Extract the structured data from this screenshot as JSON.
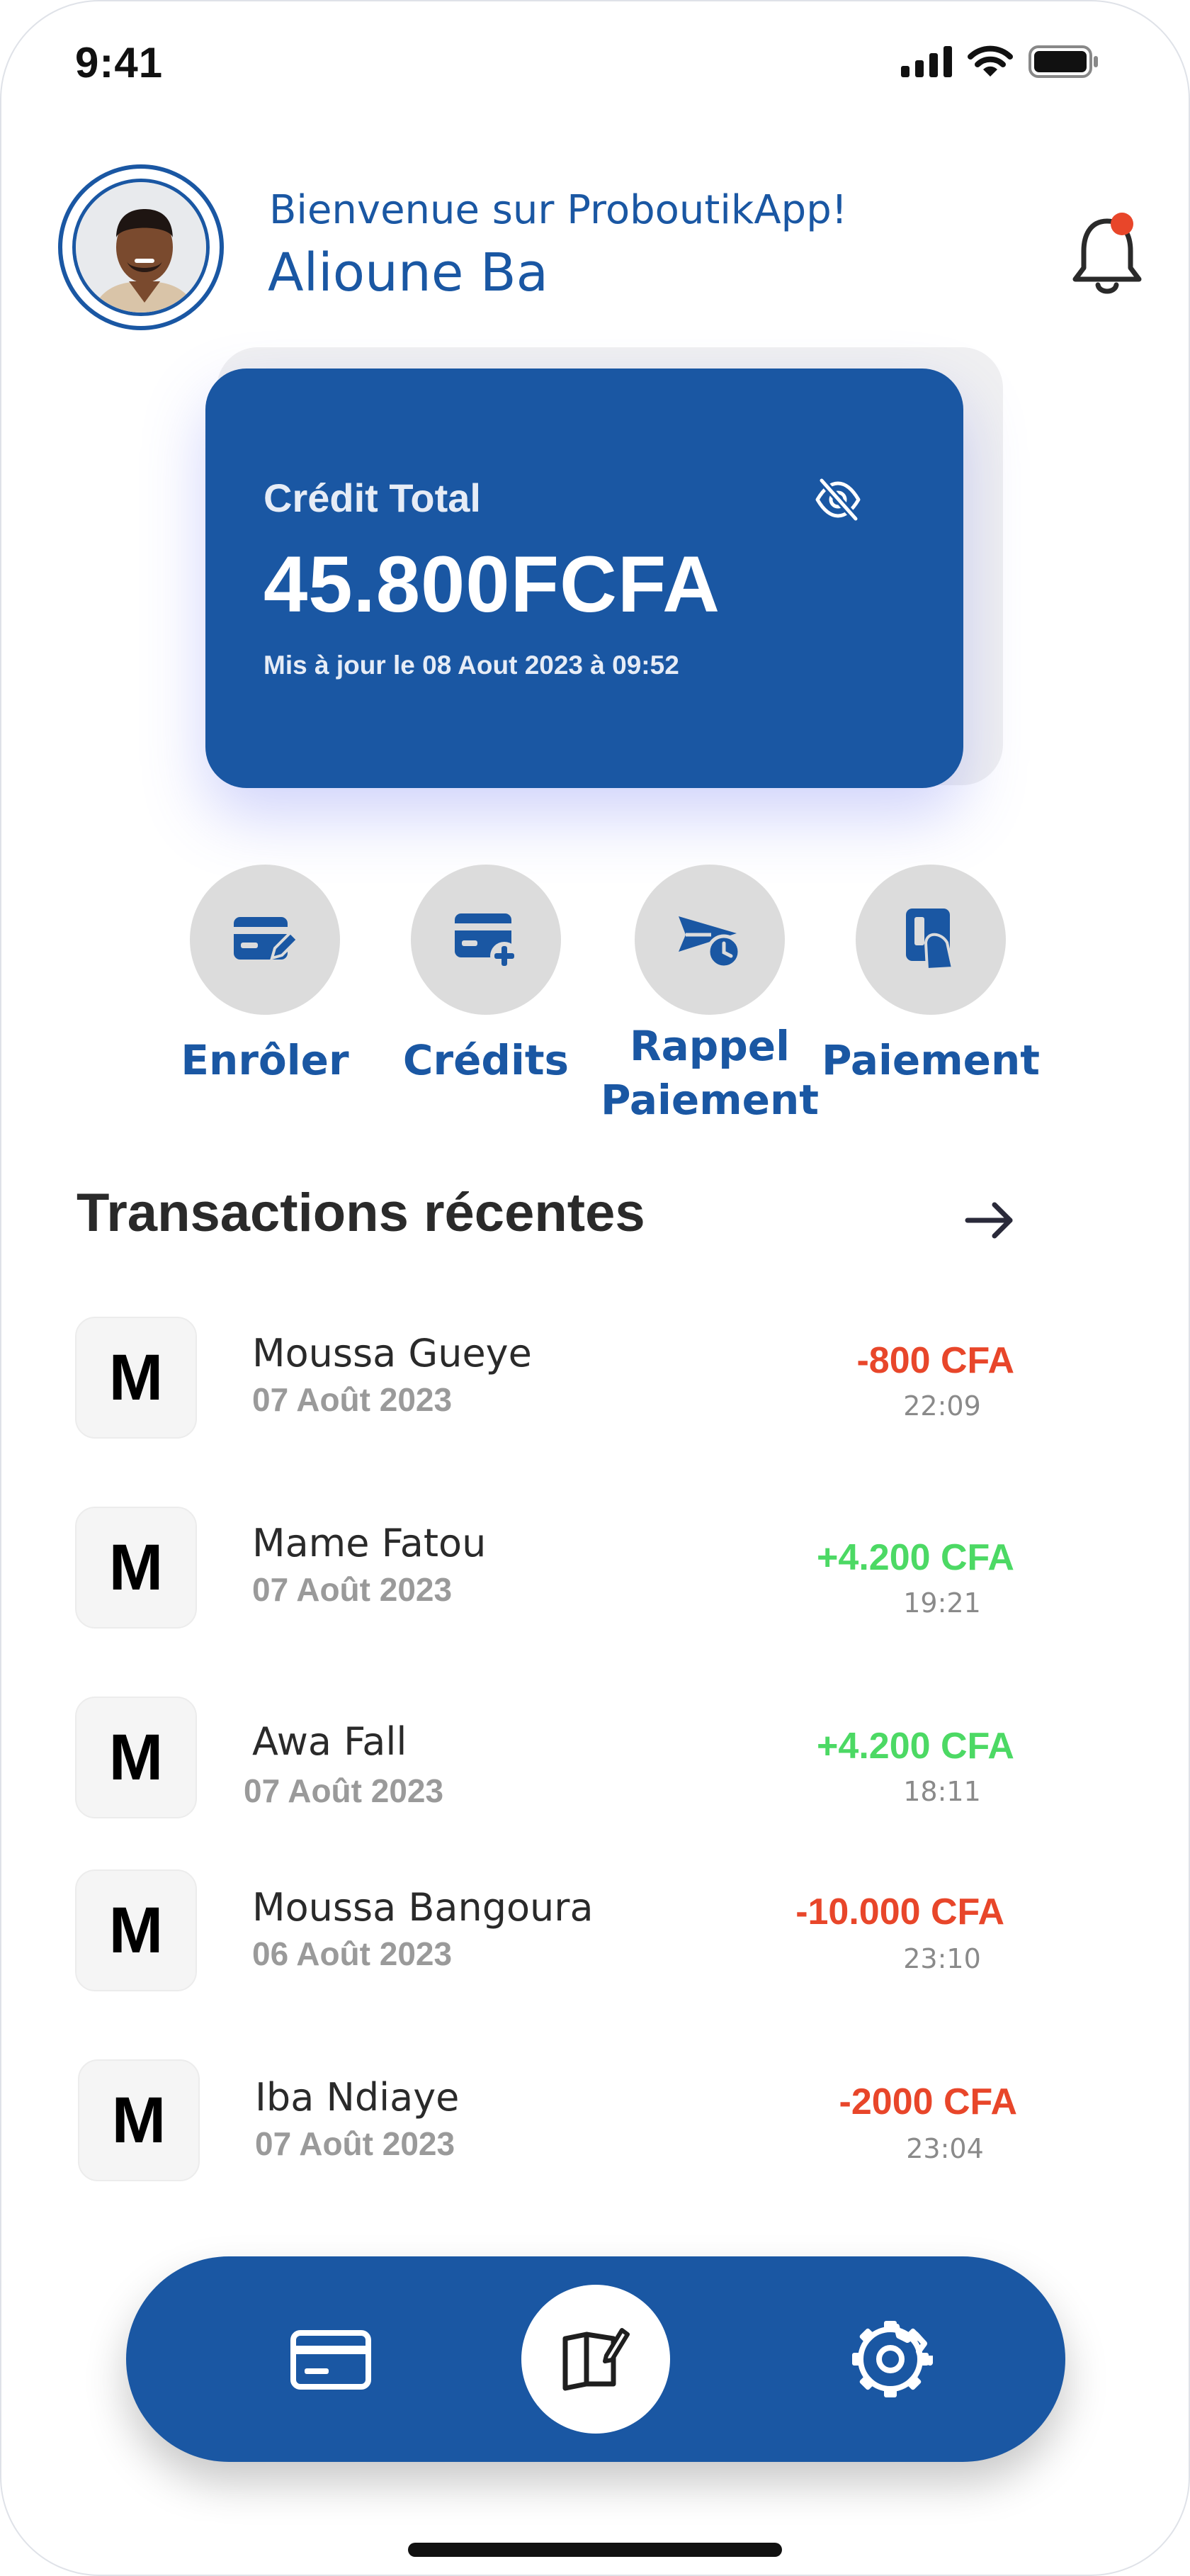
{
  "status_bar": {
    "time": "9:41"
  },
  "header": {
    "welcome": "Bienvenue sur ProboutikApp!",
    "username": "Alioune Ba"
  },
  "credit_card": {
    "label": "Crédit Total",
    "amount": "45.800FCFA",
    "updated": "Mis à jour le 08 Aout 2023 à 09:52"
  },
  "actions": [
    {
      "label": "Enrôler",
      "icon": "enroll-icon"
    },
    {
      "label": "Crédits",
      "icon": "credit-card-add-icon"
    },
    {
      "label": "Rappel Paiement",
      "icon": "send-reminder-icon"
    },
    {
      "label": "Paiement",
      "icon": "payment-card-icon"
    }
  ],
  "transactions": {
    "title": "Transactions récentes",
    "items": [
      {
        "initial": "M",
        "name": "Moussa Gueye",
        "date": "07 Août 2023",
        "amount": "-800 CFA",
        "time": "22:09",
        "type": "debit"
      },
      {
        "initial": "M",
        "name": "Mame Fatou",
        "date": "07 Août 2023",
        "amount": "+4.200 CFA",
        "time": "19:21",
        "type": "credit"
      },
      {
        "initial": "M",
        "name": "Awa Fall",
        "date": "07 Août 2023",
        "amount": "+4.200 CFA",
        "time": "18:11",
        "type": "credit"
      },
      {
        "initial": "M",
        "name": "Moussa Bangoura",
        "date": "06 Août 2023",
        "amount": "-10.000 CFA",
        "time": "23:10",
        "type": "debit"
      },
      {
        "initial": "M",
        "name": "Iba Ndiaye",
        "date": "07 Août 2023",
        "amount": "-2000 CFA",
        "time": "23:04",
        "type": "debit"
      }
    ]
  },
  "colors": {
    "brand": "#1a57a3",
    "debit": "#e8462a",
    "credit": "#4cd964"
  },
  "bottom_nav": [
    "card-icon",
    "book-edit-icon",
    "gear-icon"
  ]
}
